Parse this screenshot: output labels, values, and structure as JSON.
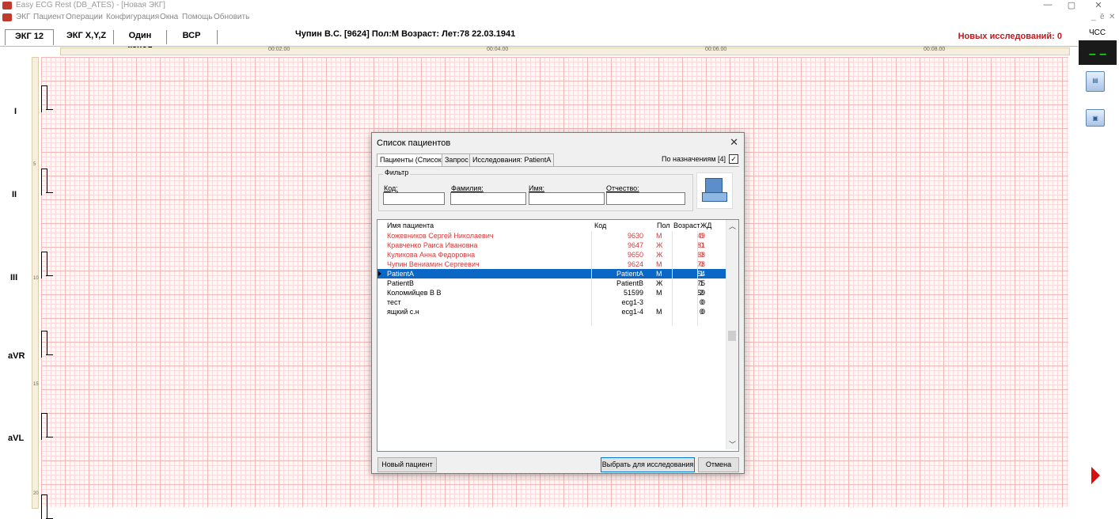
{
  "window": {
    "title": "Easy ECG Rest (DB_ATES) - [Новая ЭКГ]",
    "minimize": "—",
    "restore": "▢",
    "close": "✕"
  },
  "menu": {
    "items": [
      "ЭКГ",
      "Пациент",
      "Операции",
      "Конфигурация",
      "Окна",
      "Помощь",
      "Обновить"
    ],
    "mdi_minimize": "_",
    "mdi_restore": "ē",
    "mdi_close": "✕"
  },
  "tabs": [
    "ЭКГ 12",
    "ЭКГ X,Y,Z",
    "Один канал",
    "ВСР"
  ],
  "patient_header": "Чупин В.С. [9624]  Пол:М  Возраст: Лет:78  22.03.1941",
  "new_studies": "Новых исследований: 0",
  "timeline_marks": [
    "00:02.00",
    "00:04.00",
    "00:06.00",
    "00:08.00"
  ],
  "ruler_marks": [
    "5",
    "10",
    "15",
    "20"
  ],
  "leads": [
    "I",
    "II",
    "III",
    "aVR",
    "aVL"
  ],
  "right_panel": {
    "hcc_label": "ЧСС",
    "hcc_value": "– –"
  },
  "dialog": {
    "title": "Список пациентов",
    "close": "✕",
    "tabs": [
      "Пациенты (Список)",
      "Запрос",
      "Исследования: PatientA"
    ],
    "assign_label": "По назначениям [4]",
    "assign_checked": "✓",
    "filter": {
      "legend": "Фильтр",
      "code_label": "Код:",
      "surname_label": "Фамилия:",
      "name_label": "Имя:",
      "patronymic_label": "Отчество:"
    },
    "list": {
      "headers": {
        "name": "Имя пациента",
        "code": "Код",
        "sex": "Пол",
        "age": "Возраст",
        "zhd": "ЖД"
      },
      "rows": [
        {
          "name": "Кожевников Сергей Николаевич",
          "code": "9630",
          "sex": "М",
          "age": "49",
          "zhd": "0",
          "style": "red"
        },
        {
          "name": "Кравченко Раиса Ивановна",
          "code": "9647",
          "sex": "Ж",
          "age": "81",
          "zhd": "0",
          "style": "red"
        },
        {
          "name": "Куликова Анна Федоровна",
          "code": "9650",
          "sex": "Ж",
          "age": "68",
          "zhd": "0",
          "style": "red"
        },
        {
          "name": "Чупин Вениамин Сергеевич",
          "code": "9624",
          "sex": "М",
          "age": "78",
          "zhd": "0",
          "style": "red"
        },
        {
          "name": "PatientA",
          "code": "PatientA",
          "sex": "М",
          "age": "54",
          "zhd": "1",
          "style": "selected"
        },
        {
          "name": "PatientB",
          "code": "PatientB",
          "sex": "Ж",
          "age": "75",
          "zhd": "1",
          "style": "normal"
        },
        {
          "name": "Коломийцев В В",
          "code": "51599",
          "sex": "М",
          "age": "59",
          "zhd": "2",
          "style": "normal"
        },
        {
          "name": "тест",
          "code": "ecg1-3",
          "sex": "",
          "age": "0",
          "zhd": "0",
          "style": "normal"
        },
        {
          "name": "ящкий с.н",
          "code": "ecg1-4",
          "sex": "М",
          "age": "0",
          "zhd": "0",
          "style": "normal"
        }
      ]
    },
    "buttons": {
      "new_patient": "Новый пациент",
      "select": "Выбрать для исследования",
      "cancel": "Отмена"
    }
  }
}
